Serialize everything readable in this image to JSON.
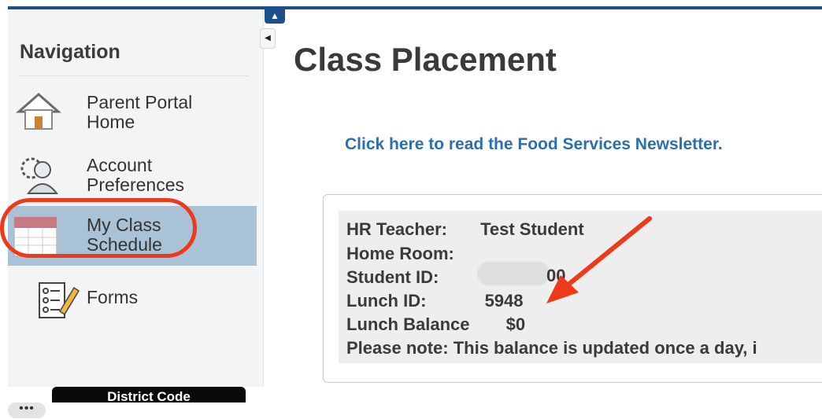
{
  "sidebar": {
    "title": "Navigation",
    "items": [
      {
        "label_line1": "Parent Portal",
        "label_line2": "Home",
        "icon": "house-icon"
      },
      {
        "label_line1": "Account",
        "label_line2": "Preferences",
        "icon": "user-gear-icon"
      },
      {
        "label_line1": "My Class",
        "label_line2": "Schedule",
        "icon": "calendar-icon",
        "active": true
      },
      {
        "label_line1": "Forms",
        "label_line2": "",
        "icon": "checklist-pencil-icon"
      }
    ],
    "district_code_label": "District Code"
  },
  "page": {
    "title": "Class Placement",
    "newsletter_link": "Click here to read the Food Services Newsletter."
  },
  "student_info": {
    "hr_teacher_label": "HR Teacher:",
    "hr_teacher_value": "Test Student",
    "home_room_label": "Home Room:",
    "home_room_value": "",
    "student_id_label": "Student ID:",
    "student_id_visible_suffix": "00",
    "lunch_id_label": "Lunch ID:",
    "lunch_id_value": "5948",
    "lunch_balance_label": "Lunch Balance",
    "lunch_balance_value": "$0",
    "note": "Please note: This balance is updated once a day, i"
  },
  "footer": {
    "more_label": "•••"
  },
  "colors": {
    "accent_blue": "#1f4e8c",
    "link_blue": "#2b6fad",
    "active_item_bg": "#a9c2d6",
    "annotation_red": "#ee3a1b"
  }
}
